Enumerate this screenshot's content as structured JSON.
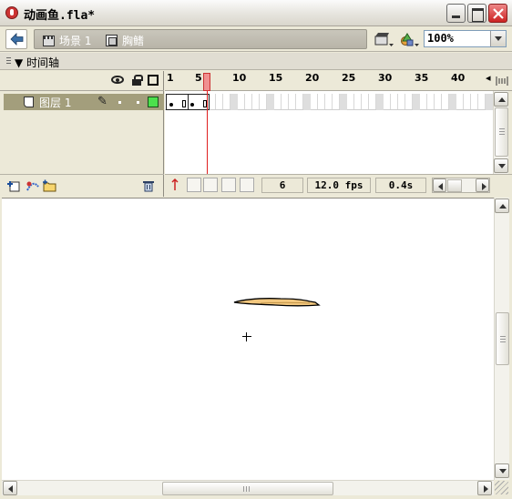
{
  "window": {
    "title": "动画鱼.fla*",
    "buttons": {
      "minimize": "minimize-icon",
      "maximize": "maximize-icon",
      "close": "close-icon"
    },
    "close_color": "#cc2222"
  },
  "scene_bar": {
    "scene_label": "场景 1",
    "symbol_label": "胸鳍",
    "zoom": "100%"
  },
  "timeline": {
    "title": "时间轴",
    "ruler_ticks": [
      "1",
      "5",
      "10",
      "15",
      "20",
      "25",
      "30",
      "35",
      "40"
    ],
    "current_frame_marker": 6,
    "layers": [
      {
        "name": "图层 1",
        "color": "#4ce04c",
        "selected": true
      }
    ],
    "status": {
      "frame": "6",
      "fps": "12.0 fps",
      "time": "0.4s"
    }
  },
  "stage": {
    "shape_color": "#f2c77e"
  }
}
